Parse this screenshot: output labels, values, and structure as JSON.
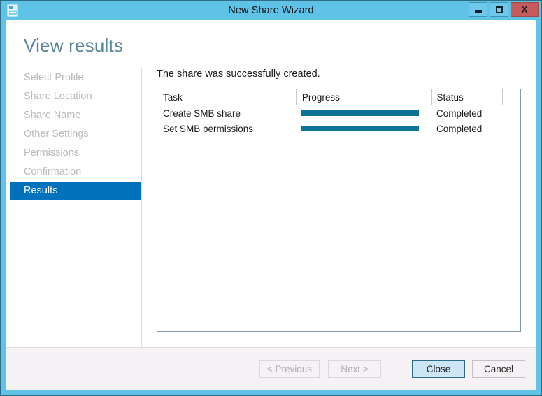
{
  "window": {
    "title": "New Share Wizard",
    "icon": "share-wizard-icon",
    "controls": {
      "minimize_label": "–",
      "maximize_label": "□",
      "close_label": "X"
    },
    "frame_color": "#5fc3e8"
  },
  "page": {
    "heading": "View results",
    "heading_color": "#5a8499"
  },
  "nav": {
    "items": [
      {
        "label": "Select Profile",
        "state": "done"
      },
      {
        "label": "Share Location",
        "state": "done"
      },
      {
        "label": "Share Name",
        "state": "done"
      },
      {
        "label": "Other Settings",
        "state": "done"
      },
      {
        "label": "Permissions",
        "state": "done"
      },
      {
        "label": "Confirmation",
        "state": "done"
      },
      {
        "label": "Results",
        "state": "active"
      }
    ],
    "active_color": "#0072bc"
  },
  "main": {
    "intro": "The share was successfully created.",
    "table": {
      "columns": [
        "Task",
        "Progress",
        "Status",
        ""
      ],
      "rows": [
        {
          "task": "Create SMB share",
          "progress": 100,
          "status": "Completed"
        },
        {
          "task": "Set SMB permissions",
          "progress": 100,
          "status": "Completed"
        }
      ],
      "progress_color": "#0d7395"
    }
  },
  "footer": {
    "buttons": [
      {
        "label": "< Previous",
        "state": "disabled"
      },
      {
        "label": "Next >",
        "state": "disabled"
      },
      {
        "label": "Close",
        "state": "default"
      },
      {
        "label": "Cancel",
        "state": "enabled"
      }
    ]
  }
}
